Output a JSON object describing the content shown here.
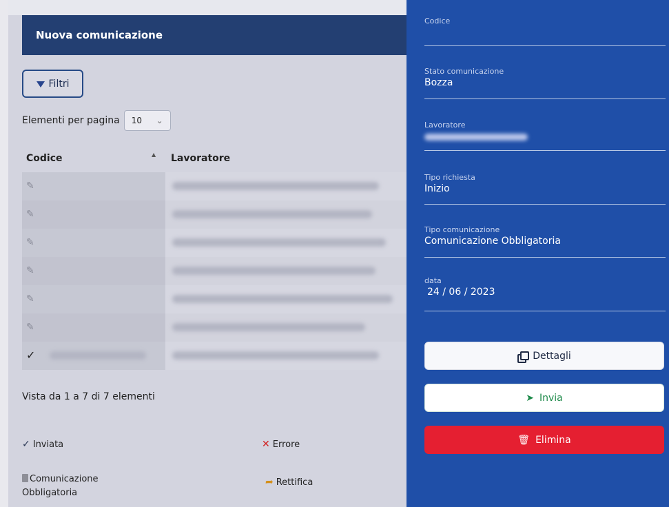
{
  "left": {
    "header_title": "Nuova comunicazione",
    "filter_label": "Filtri",
    "per_page_label": "Elementi per pagina",
    "per_page_value": "10",
    "table": {
      "col_codice": "Codice",
      "col_lavoratore": "Lavoratore"
    },
    "status_text": "Vista da 1 a 7 di 7 elementi",
    "legend": {
      "inviata": "Inviata",
      "errore": "Errore",
      "comunicazione": "Comunicazione Obbligatoria",
      "rettifica": "Rettifica"
    }
  },
  "right": {
    "codice": {
      "label": "Codice",
      "value": ""
    },
    "stato": {
      "label": "Stato comunicazione",
      "value": "Bozza"
    },
    "lavoratore": {
      "label": "Lavoratore",
      "value": ""
    },
    "tipo_richiesta": {
      "label": "Tipo richiesta",
      "value": "Inizio"
    },
    "tipo_comunicazione": {
      "label": "Tipo comunicazione",
      "value": "Comunicazione Obbligatoria"
    },
    "data": {
      "label": "data",
      "value": "24 / 06 / 2023"
    },
    "buttons": {
      "dettagli": "Dettagli",
      "invia": "Invia",
      "elimina": "Elimina"
    }
  },
  "colors": {
    "header_bg": "#233f72",
    "panel_bg": "#1f4fa8",
    "danger": "#e51f31",
    "success": "#1e8a4a"
  }
}
